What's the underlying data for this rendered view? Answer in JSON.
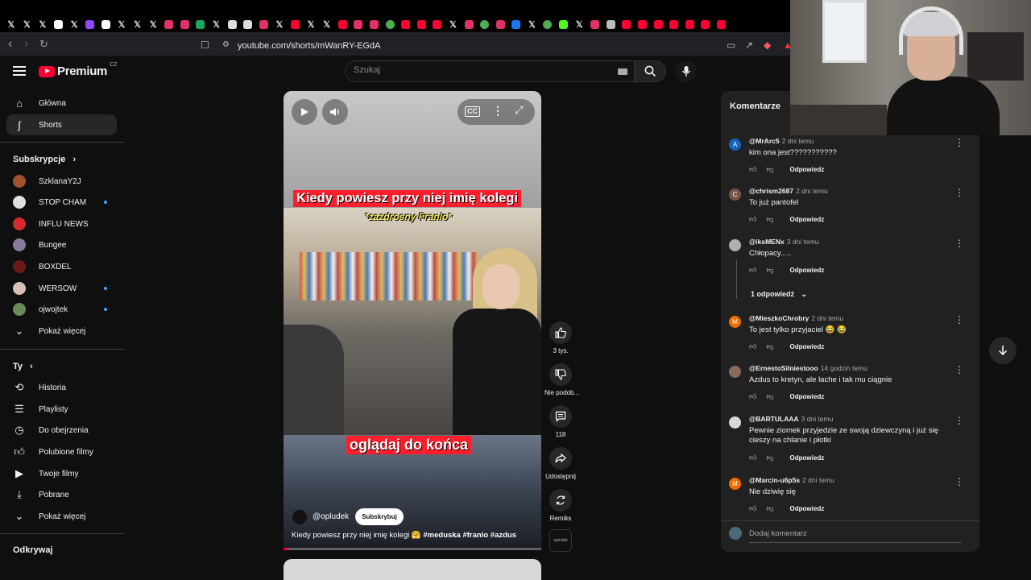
{
  "browser": {
    "url": "youtube.com/shorts/mWanRY-EGdA",
    "tabs": [
      "X",
      "X",
      "X",
      "tiktok",
      "X",
      "twitch",
      "tiktok",
      "X",
      "X",
      "X",
      "instagram",
      "instagram",
      "sheets",
      "X",
      "fb",
      "fb",
      "instagram",
      "X",
      "youtube",
      "X",
      "X",
      "youtube",
      "instagram",
      "notion",
      "chrome",
      "youtube",
      "youtube",
      "youtube",
      "X",
      "instagram",
      "chrome",
      "instagram",
      "facebook",
      "X",
      "chrome",
      "kick",
      "X",
      "instagram",
      "github",
      "youtube",
      "youtube",
      "youtube",
      "youtube",
      "youtube",
      "youtube",
      "youtube"
    ],
    "colors": {
      "tab_bar": "#000000",
      "address_bar": "#202124"
    }
  },
  "header": {
    "logo": "Premium",
    "country": "CZ",
    "search_placeholder": "Szukaj"
  },
  "sidebar": {
    "main": [
      {
        "label": "Główna",
        "icon": "home-icon"
      },
      {
        "label": "Shorts",
        "icon": "shorts-icon",
        "active": true
      }
    ],
    "subscriptions_title": "Subskrypcje",
    "subscriptions": [
      {
        "label": "SzklanaY2J",
        "color": "#a0522d",
        "live": false
      },
      {
        "label": "STOP CHAM",
        "color": "#e0e0e0",
        "live": true
      },
      {
        "label": "INFLU NEWS",
        "color": "#d42c2c",
        "live": false
      },
      {
        "label": "Bungee",
        "color": "#8a7a9a",
        "live": false
      },
      {
        "label": "BOXDEL",
        "color": "#6a1a1a",
        "live": false
      },
      {
        "label": "WERSOW",
        "color": "#d8c0b8",
        "live": true
      },
      {
        "label": "ojwojtek",
        "color": "#6a8a5a",
        "live": true
      }
    ],
    "show_more": "Pokaż więcej",
    "you_title": "Ty",
    "you": [
      {
        "label": "Historia",
        "icon": "history-icon"
      },
      {
        "label": "Playlisty",
        "icon": "playlists-icon"
      },
      {
        "label": "Do obejrzenia",
        "icon": "watch-later-icon"
      },
      {
        "label": "Polubione filmy",
        "icon": "liked-icon"
      },
      {
        "label": "Twoje filmy",
        "icon": "your-videos-icon"
      },
      {
        "label": "Pobrane",
        "icon": "downloads-icon"
      }
    ],
    "show_more_2": "Pokaż więcej",
    "explore_title": "Odkrywaj"
  },
  "video": {
    "caption_top": "Kiedy powiesz przy niej imię kolegi",
    "caption_sub": "*zazdrosny Franio*",
    "caption_bottom": "oglądaj do końca",
    "channel": "@opludek",
    "subscribe": "Subskrybuj",
    "title": "Kiedy powiesz przy niej imię kolegi 🤗",
    "hashtags": "#meduska #franio #azdus",
    "progress": 0.02
  },
  "actions": {
    "likes": "3 tys.",
    "dislike": "Nie podob...",
    "comments": "118",
    "share": "Udostępnij",
    "remix": "Remiks",
    "channel_thumb": "opludek"
  },
  "comments_panel": {
    "title": "Komentarze",
    "reply_label": "Odpowiedz",
    "replies_toggle": "1 odpowiedź",
    "add_placeholder": "Dodaj komentarz",
    "items": [
      {
        "author": "@MrArc5",
        "time": "2 dni temu",
        "text": "kim ona jest???????????",
        "avatar": "A",
        "color": "#1565c0"
      },
      {
        "author": "@chrism2687",
        "time": "2 dni temu",
        "text": "To już pantofel",
        "avatar": "C",
        "color": "#795548"
      },
      {
        "author": "@iksMENx",
        "time": "3 dni temu",
        "text": "Chłopacy.....",
        "avatar": "",
        "color": "#b0b0b0"
      },
      {
        "author": "@MieszkoChrobry",
        "time": "2 dni temu",
        "text": "To jest tylko przyjaciel 😂 😂",
        "avatar": "M",
        "color": "#ef6c00"
      },
      {
        "author": "@ErnestoSilniestooo",
        "time": "14 godzin temu",
        "text": "Azdus to kretyn, ale lache i tak mu ciągnie",
        "avatar": "",
        "color": "#8a6a5a"
      },
      {
        "author": "@BARTULAAA",
        "time": "3 dni temu",
        "text": "Pewnie ziomek przyjedzie ze swoją dziewczyną i już się cieszy na chlanie i płotki",
        "avatar": "",
        "color": "#d8d8d8"
      },
      {
        "author": "@Marcin-u6p5s",
        "time": "2 dni temu",
        "text": "Nie dziwię się",
        "avatar": "M",
        "color": "#ef6c00"
      }
    ]
  }
}
